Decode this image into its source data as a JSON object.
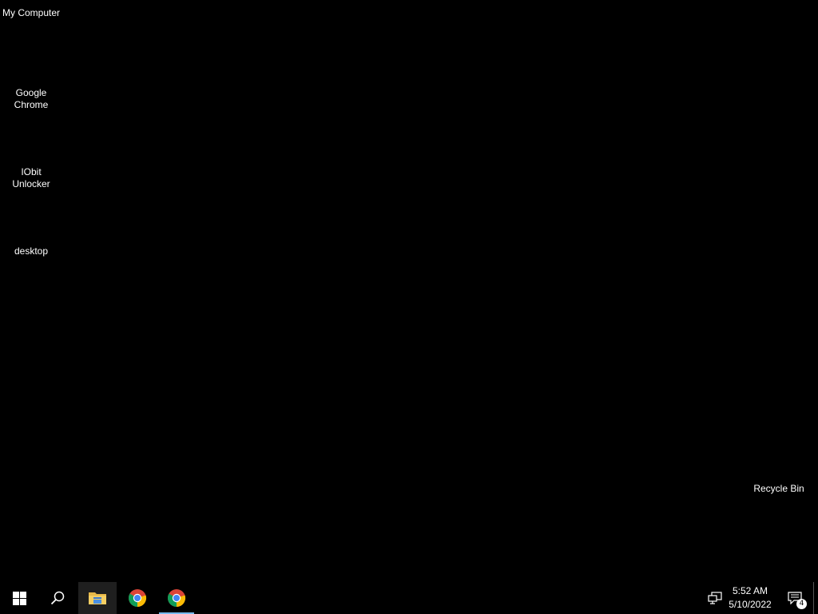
{
  "desktop": {
    "background": "#000000",
    "icons": [
      {
        "label": "My Computer",
        "icon": "computer-icon"
      },
      {
        "label": "Google\nChrome",
        "icon": "chrome-icon"
      },
      {
        "label": "IObit\nUnlocker",
        "icon": "iobit-unlocker-icon"
      },
      {
        "label": "desktop",
        "icon": "folder-icon"
      },
      {
        "label": "Recycle Bin",
        "icon": "recycle-bin-icon"
      }
    ]
  },
  "taskbar": {
    "background": "#000000",
    "accent": "#76b9ed",
    "buttons": [
      {
        "name": "start-button",
        "icon": "windows-logo-icon"
      },
      {
        "name": "search-button",
        "icon": "search-icon"
      },
      {
        "name": "file-explorer-button",
        "icon": "file-explorer-icon",
        "active": true
      },
      {
        "name": "chrome-button",
        "icon": "chrome-icon"
      },
      {
        "name": "chrome-running-button",
        "icon": "chrome-icon",
        "running": true
      }
    ],
    "tray": {
      "network_icon": "network-icon",
      "time": "5:52 AM",
      "date": "5/10/2022",
      "notifications_icon": "action-center-icon",
      "notification_count": "4"
    }
  }
}
